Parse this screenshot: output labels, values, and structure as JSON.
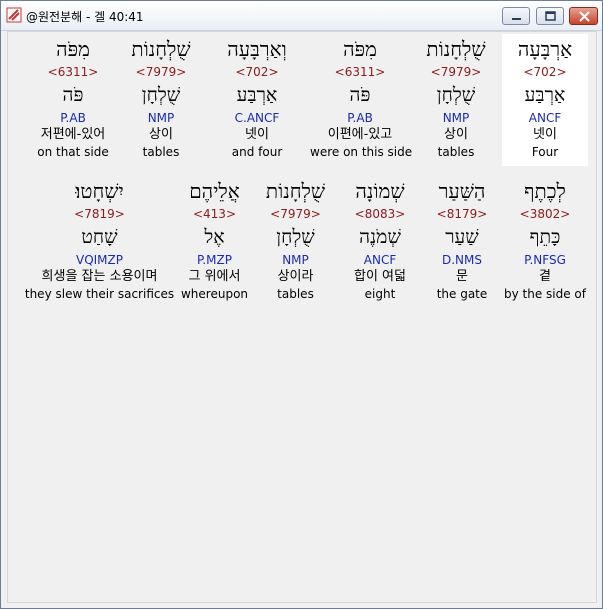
{
  "window": {
    "title": "@원전분해 - 겔 40:41"
  },
  "rows": [
    [
      {
        "heb": "אַרְבָּעָה",
        "strong": "<702>",
        "lex": "אַרְבַּע",
        "morph": "ANCF",
        "kor": "넷이",
        "eng": "Four",
        "selected": true
      },
      {
        "heb": "שֻׁלְחָנוֹת",
        "strong": "<7979>",
        "lex": "שֻׁלְחָן",
        "morph": "NMP",
        "kor": "상이",
        "eng": "tables"
      },
      {
        "heb": "מִפֹּה",
        "strong": "<6311>",
        "lex": "פֹּה",
        "morph": "P.AB",
        "kor": "이편에-있고",
        "eng": "were on this side"
      },
      {
        "heb": "וְאַרְבָּעָה",
        "strong": "<702>",
        "lex": "אַרְבַּע",
        "morph": "C.ANCF",
        "kor": "넷이",
        "eng": "and four"
      },
      {
        "heb": "שֻׁלְחָנוֹת",
        "strong": "<7979>",
        "lex": "שֻׁלְחָן",
        "morph": "NMP",
        "kor": "상이",
        "eng": "tables"
      },
      {
        "heb": "מִפֹּה",
        "strong": "<6311>",
        "lex": "פֹּה",
        "morph": "P.AB",
        "kor": "저편에-있어",
        "eng": "on that side"
      }
    ],
    [
      {
        "heb": "לְכֶתֶף",
        "strong": "<3802>",
        "lex": "כָּתֵף",
        "morph": "P.NFSG",
        "kor": "곁",
        "eng": "by the side of"
      },
      {
        "heb": "הַשַּׁעַר",
        "strong": "<8179>",
        "lex": "שַׁעַר",
        "morph": "D.NMS",
        "kor": "문",
        "eng": "the gate"
      },
      {
        "heb": "שְׁמוֹנָה",
        "strong": "<8083>",
        "lex": "שְׁמֹנֶה",
        "morph": "ANCF",
        "kor": "합이 여덟",
        "eng": "eight"
      },
      {
        "heb": "שֻׁלְחָנוֹת",
        "strong": "<7979>",
        "lex": "שֻׁלְחָן",
        "morph": "NMP",
        "kor": "상이라",
        "eng": "tables"
      },
      {
        "heb": "אֲלֵיהֶם",
        "strong": "<413>",
        "lex": "אֶל",
        "morph": "P.MZP",
        "kor": "그 위에서",
        "eng": "whereupon"
      },
      {
        "heb": "יִשְׁחָטוּ׃",
        "strong": "<7819>",
        "lex": "שָׁחַט",
        "morph": "VQIMZP",
        "kor": "희생을 잡는 소용이며",
        "eng": "they slew their sacrifices"
      }
    ]
  ]
}
